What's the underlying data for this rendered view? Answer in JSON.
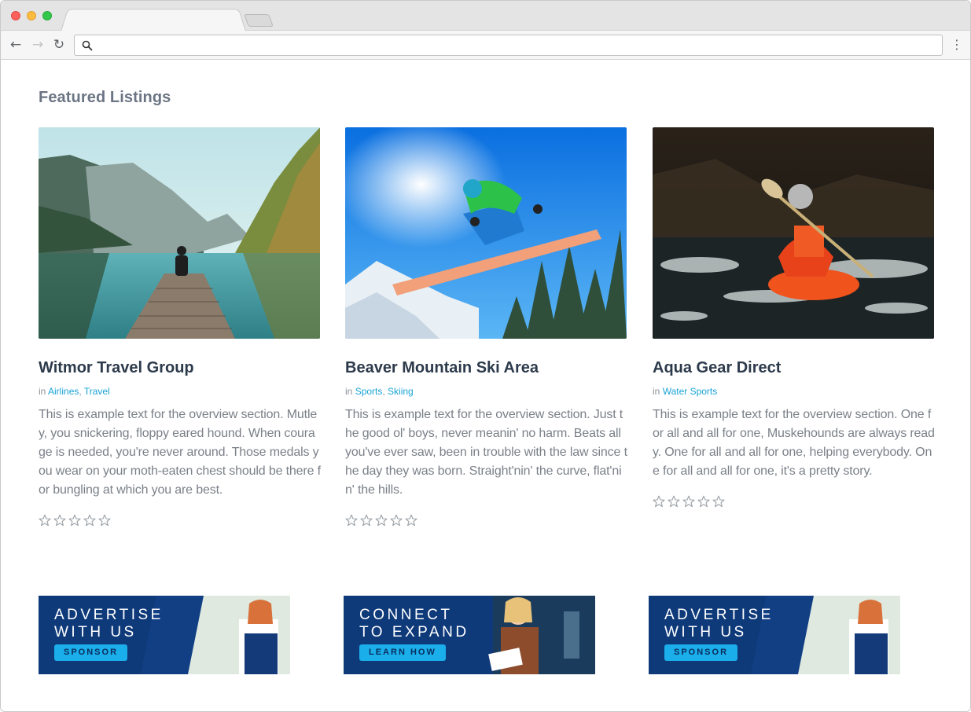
{
  "browser": {
    "address_value": "",
    "icons": [
      "back-arrow-icon",
      "forward-arrow-icon",
      "reload-icon",
      "search-icon",
      "more-menu-icon"
    ]
  },
  "section": {
    "title": "Featured Listings"
  },
  "listings": [
    {
      "title": "Witmor Travel Group",
      "in_label": "in",
      "categories": [
        "Airlines",
        "Travel"
      ],
      "description": "This is example text for the overview section. Mutley, you snickering, floppy eared hound. When courage is needed, you're never around. Those medals you wear on your moth-eaten chest should be there for bungling at which you are best.",
      "rating": 0,
      "rating_max": 5,
      "image": "mountain-lake-dock-photo"
    },
    {
      "title": "Beaver Mountain Ski Area",
      "in_label": "in",
      "categories": [
        "Sports",
        "Skiing"
      ],
      "description": "This is example text for the overview section. Just the good ol' boys, never meanin' no harm. Beats all you've ever saw, been in trouble with the law since the day they was born. Straight'nin' the curve, flat'nin' the hills.",
      "rating": 0,
      "rating_max": 5,
      "image": "snowboarder-jump-photo"
    },
    {
      "title": "Aqua Gear Direct",
      "in_label": "in",
      "categories": [
        "Water Sports"
      ],
      "description": "This is example text for the overview section. One for all and all for one, Muskehounds are always ready. One for all and all for one, helping everybody. One for all and all for one, it's a pretty story.",
      "rating": 0,
      "rating_max": 5,
      "image": "kayaker-rapids-photo"
    }
  ],
  "banners": [
    {
      "headline": "ADVERTISE\nWITH US",
      "button": "SPONSOR"
    },
    {
      "headline": "CONNECT\nTO EXPAND",
      "button": "LEARN HOW"
    },
    {
      "headline": "ADVERTISE\nWITH US",
      "button": "SPONSOR"
    }
  ],
  "colors": {
    "link": "#1aa3d6",
    "title": "#2c3a4b",
    "section_title": "#6c7584",
    "banner_bg": "#0f3a7a",
    "banner_button": "#1aaeea"
  }
}
